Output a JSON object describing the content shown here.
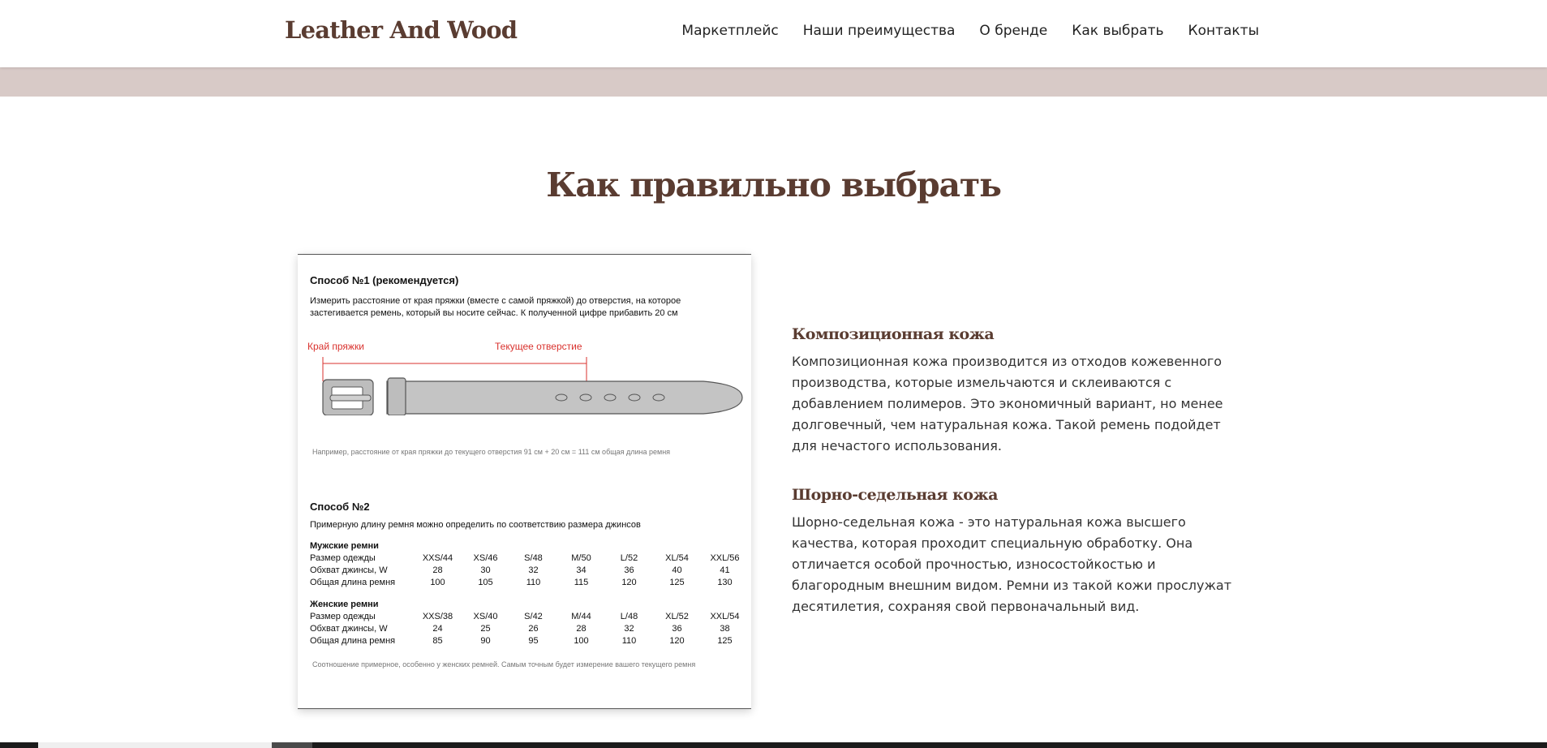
{
  "brand": "Leather And Wood",
  "nav": [
    "Маркетплейс",
    "Наши преимущества",
    "О бренде",
    "Как выбрать",
    "Контакты"
  ],
  "section_title": "Как правильно выбрать",
  "guide": {
    "method1_title": "Способ №1 (рекомендуется)",
    "method1_text": "Измерить расстояние от края пряжки (вместе с самой пряжкой) до отверстия, на которое застегивается ремень, который вы носите сейчас. К полученной цифре прибавить 20 см",
    "label_buckle_edge": "Край пряжки",
    "label_current_hole": "Текущее отверстие",
    "example_note": "Например, расстояние от края пряжки до текущего отверстия 91 см + 20 см = 111 см общая длина ремня",
    "method2_title": "Способ №2",
    "method2_text": "Примерную длину ремня можно определить по соответствию размера джинсов",
    "row_labels": [
      "Размер одежды",
      "Обхват джинсы, W",
      "Общая длина ремня"
    ],
    "men": {
      "caption": "Мужские ремни",
      "sizes": [
        "XXS/44",
        "XS/46",
        "S/48",
        "M/50",
        "L/52",
        "XL/54",
        "XXL/56"
      ],
      "waist": [
        "28",
        "30",
        "32",
        "34",
        "36",
        "40",
        "41"
      ],
      "length": [
        "100",
        "105",
        "110",
        "115",
        "120",
        "125",
        "130"
      ]
    },
    "women": {
      "caption": "Женские ремни",
      "sizes": [
        "XXS/38",
        "XS/40",
        "S/42",
        "M/44",
        "L/48",
        "XL/52",
        "XXL/54"
      ],
      "waist": [
        "24",
        "25",
        "26",
        "28",
        "32",
        "36",
        "38"
      ],
      "length": [
        "85",
        "90",
        "95",
        "100",
        "110",
        "120",
        "125"
      ]
    },
    "footnote": "Соотношение примерное, особенно у женских ремней. Самым точным будет измерение вашего текущего ремня"
  },
  "materials": [
    {
      "title": "Композиционная кожа",
      "text": "Композиционная кожа производится из отходов кожевенного производства, которые измельчаются и склеиваются с добавлением полимеров. Это экономичный вариант, но менее долговечный, чем натуральная кожа. Такой ремень подойдет для нечастого использования."
    },
    {
      "title": "Шорно-седельная кожа",
      "text": "Шорно-седельная кожа - это натуральная кожа высшего качества, которая проходит специальную обработку. Она отличается особой прочностью, износостойкостью и благородным внешним видом. Ремни из такой кожи прослужат десятилетия, сохраняя свой первоначальный вид."
    }
  ],
  "colors": {
    "brand": "#5a3c31",
    "band": "#d8cac7",
    "accent_red": "#d9322e",
    "belt": "#c4c4c4"
  }
}
